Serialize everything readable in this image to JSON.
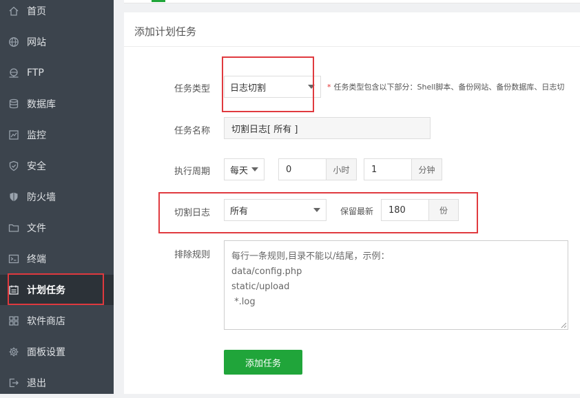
{
  "colors": {
    "sidebar_bg": "#3c444d",
    "accent_green": "#20a53a",
    "highlight_red": "#e0393e"
  },
  "sidebar": {
    "items": [
      {
        "label": "首页",
        "icon": "home-icon"
      },
      {
        "label": "网站",
        "icon": "globe-icon"
      },
      {
        "label": "FTP",
        "icon": "ftp-icon"
      },
      {
        "label": "数据库",
        "icon": "database-icon"
      },
      {
        "label": "监控",
        "icon": "monitor-icon"
      },
      {
        "label": "安全",
        "icon": "shield-check-icon"
      },
      {
        "label": "防火墙",
        "icon": "firewall-shield-icon"
      },
      {
        "label": "文件",
        "icon": "folder-icon"
      },
      {
        "label": "终端",
        "icon": "terminal-icon"
      },
      {
        "label": "计划任务",
        "icon": "calendar-icon",
        "active": true
      },
      {
        "label": "软件商店",
        "icon": "apps-grid-icon"
      },
      {
        "label": "面板设置",
        "icon": "gear-icon"
      },
      {
        "label": "退出",
        "icon": "logout-icon"
      }
    ]
  },
  "panel": {
    "title": "添加计划任务"
  },
  "form": {
    "task_type": {
      "label": "任务类型",
      "value": "日志切割",
      "hint_star": "*",
      "hint": "任务类型包含以下部分：Shell脚本、备份网站、备份数据库、日志切"
    },
    "task_name": {
      "label": "任务名称",
      "value": "切割日志[ 所有 ]"
    },
    "period": {
      "label": "执行周期",
      "frequency": "每天",
      "hour_value": "0",
      "hour_unit": "小时",
      "minute_value": "1",
      "minute_unit": "分钟"
    },
    "log_cut": {
      "label": "切割日志",
      "value": "所有",
      "retain_label": "保留最新",
      "retain_value": "180",
      "retain_unit": "份"
    },
    "exclude": {
      "label": "排除规则",
      "placeholder_lines": [
        "每行一条规则,目录不能以/结尾，示例：",
        "data/config.php",
        "static/upload",
        " *.log"
      ]
    },
    "submit_label": "添加任务"
  }
}
